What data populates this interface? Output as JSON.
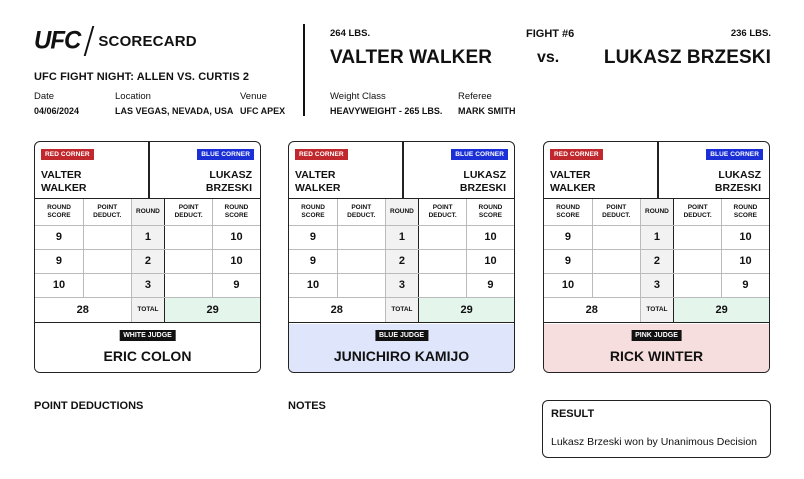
{
  "header": {
    "logo_text": "UFC",
    "title": "SCORECARD",
    "event": "UFC FIGHT NIGHT: ALLEN VS. CURTIS 2",
    "date_label": "Date",
    "date": "04/06/2024",
    "location_label": "Location",
    "location": "LAS VEGAS, NEVADA, USA",
    "venue_label": "Venue",
    "venue": "UFC APEX"
  },
  "fight": {
    "number": "FIGHT #6",
    "vs": "vs.",
    "red": {
      "name": "VALTER WALKER",
      "weight": "264 LBS."
    },
    "blue": {
      "name": "LUKASZ BRZESKI",
      "weight": "236 LBS."
    },
    "weight_class_label": "Weight Class",
    "weight_class": "HEAVYWEIGHT - 265 LBS.",
    "referee_label": "Referee",
    "referee": "MARK SMITH"
  },
  "table_headers": {
    "round_score": "ROUND SCORE",
    "point_deduct": "POINT DEDUCT.",
    "round": "ROUND",
    "total": "TOTAL"
  },
  "corner_labels": {
    "red": "RED CORNER",
    "blue": "BLUE CORNER"
  },
  "corner_names": {
    "red_first": "VALTER",
    "red_last": "WALKER",
    "blue_first": "LUKASZ",
    "blue_last": "BRZESKI"
  },
  "cards": [
    {
      "judge_label": "WHITE JUDGE",
      "judge_name": "ERIC COLON",
      "judge_bg": "#ffffff",
      "rounds": [
        {
          "round": "1",
          "red": "9",
          "blue": "10"
        },
        {
          "round": "2",
          "red": "9",
          "blue": "10"
        },
        {
          "round": "3",
          "red": "10",
          "blue": "9"
        }
      ],
      "red_total": "28",
      "blue_total": "29"
    },
    {
      "judge_label": "BLUE JUDGE",
      "judge_name": "JUNICHIRO KAMIJO",
      "judge_bg": "#dfe6fb",
      "rounds": [
        {
          "round": "1",
          "red": "9",
          "blue": "10"
        },
        {
          "round": "2",
          "red": "9",
          "blue": "10"
        },
        {
          "round": "3",
          "red": "10",
          "blue": "9"
        }
      ],
      "red_total": "28",
      "blue_total": "29"
    },
    {
      "judge_label": "PINK JUDGE",
      "judge_name": "RICK WINTER",
      "judge_bg": "#f7dede",
      "rounds": [
        {
          "round": "1",
          "red": "9",
          "blue": "10"
        },
        {
          "round": "2",
          "red": "9",
          "blue": "10"
        },
        {
          "round": "3",
          "red": "10",
          "blue": "9"
        }
      ],
      "red_total": "28",
      "blue_total": "29"
    }
  ],
  "footer": {
    "point_deductions_title": "POINT DEDUCTIONS",
    "notes_title": "NOTES",
    "result_title": "RESULT",
    "result_text": "Lukasz Brzeski won by Unanimous Decision"
  },
  "colors": {
    "red_corner": "#c0282d",
    "blue_corner": "#1a2fd6",
    "winner_total": "#e4f5ec"
  }
}
